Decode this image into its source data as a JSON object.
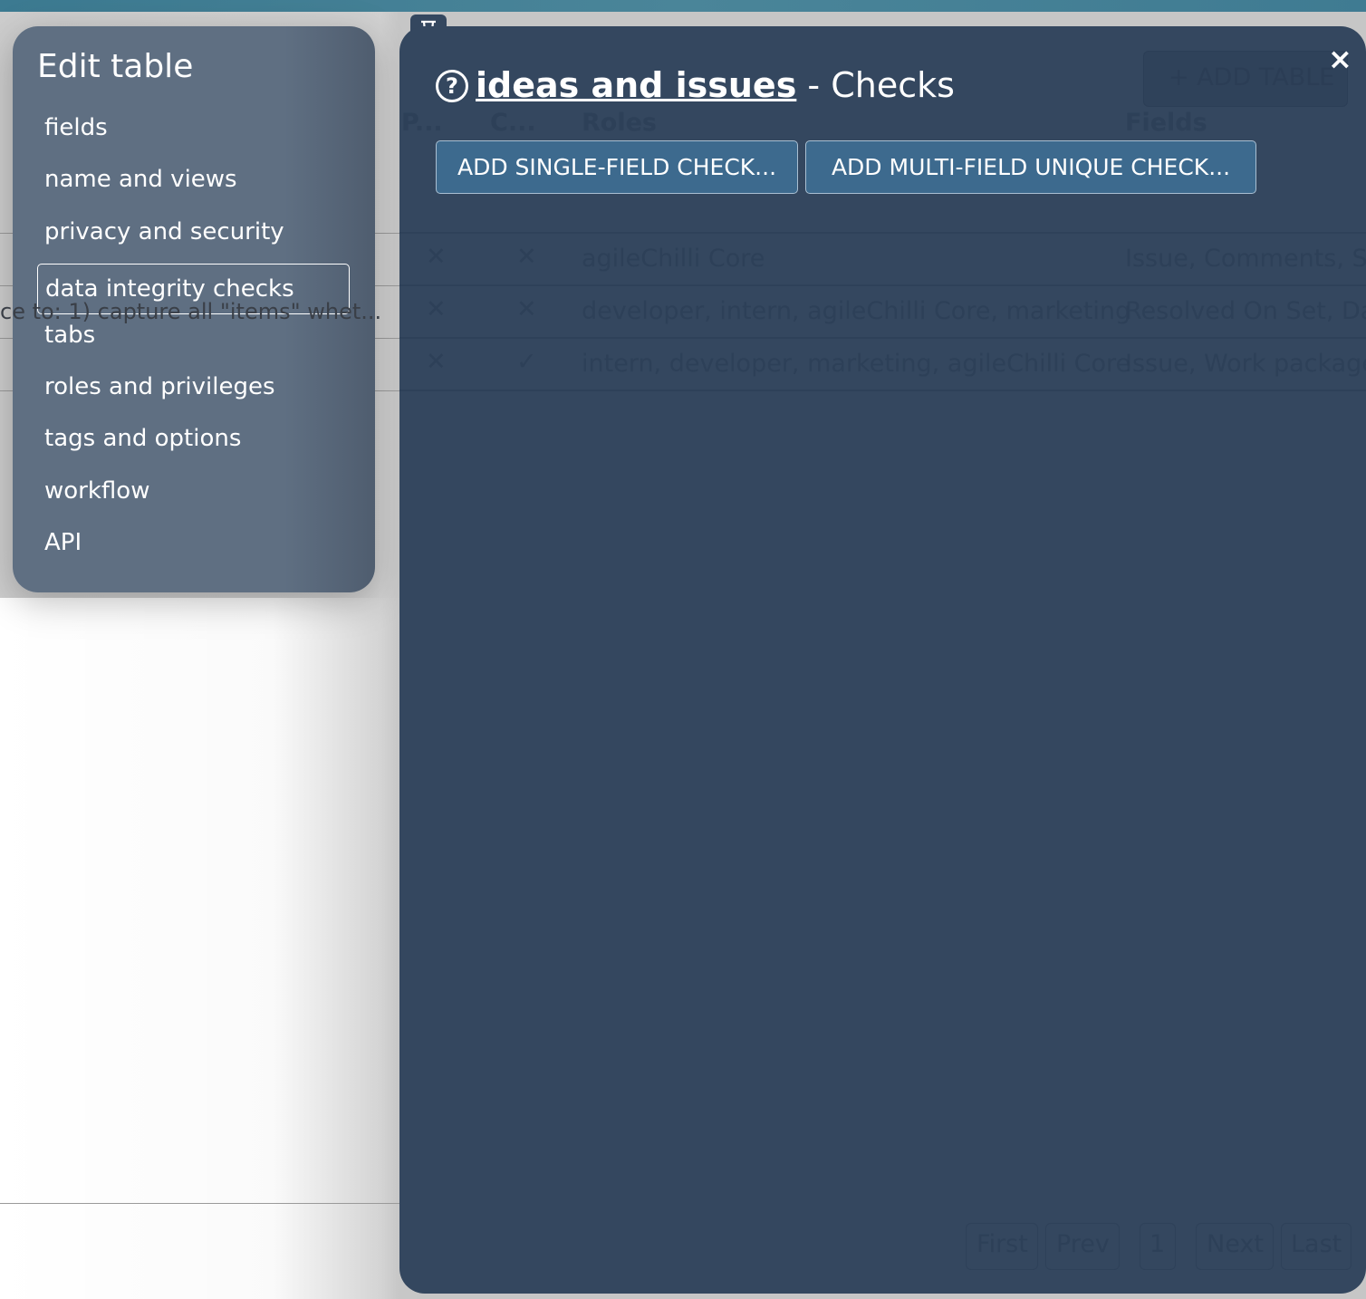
{
  "background": {
    "snippet": "ce to: 1) capture all \"items\" whet..."
  },
  "sidebar": {
    "title": "Edit table",
    "items": [
      {
        "label": "fields"
      },
      {
        "label": "name and views"
      },
      {
        "label": "privacy and security"
      },
      {
        "label": "data integrity checks",
        "active": true
      },
      {
        "label": "tabs"
      },
      {
        "label": "roles and privileges"
      },
      {
        "label": "tags and options"
      },
      {
        "label": "workflow"
      },
      {
        "label": "API"
      }
    ]
  },
  "panel": {
    "title_link": "ideas and issues",
    "title_suffix": " - Checks",
    "help_icon": "?",
    "close_icon": "×",
    "buttons": {
      "single": "ADD SINGLE-FIELD CHECK...",
      "multi": "ADD MULTI-FIELD UNIQUE CHECK..."
    },
    "behind": {
      "add_table": "+ ADD TABLE",
      "headers": [
        "P...",
        "C...",
        "Roles",
        "Fields"
      ],
      "rows": [
        {
          "p": "✕",
          "c": "✕",
          "roles": "agileChilli Core",
          "fields": "Issue, Comments, Sol"
        },
        {
          "p": "✕",
          "c": "✕",
          "roles": "developer, intern, agileChilli Core, marketing",
          "fields": "Resolved On Set, Date"
        },
        {
          "p": "✕",
          "c": "✓",
          "roles": "intern, developer, marketing, agileChilli Core",
          "fields": "Issue, Work package"
        }
      ],
      "pager": {
        "first": "First",
        "prev": "Prev",
        "page": "1",
        "next": "Next",
        "last": "Last"
      }
    }
  }
}
